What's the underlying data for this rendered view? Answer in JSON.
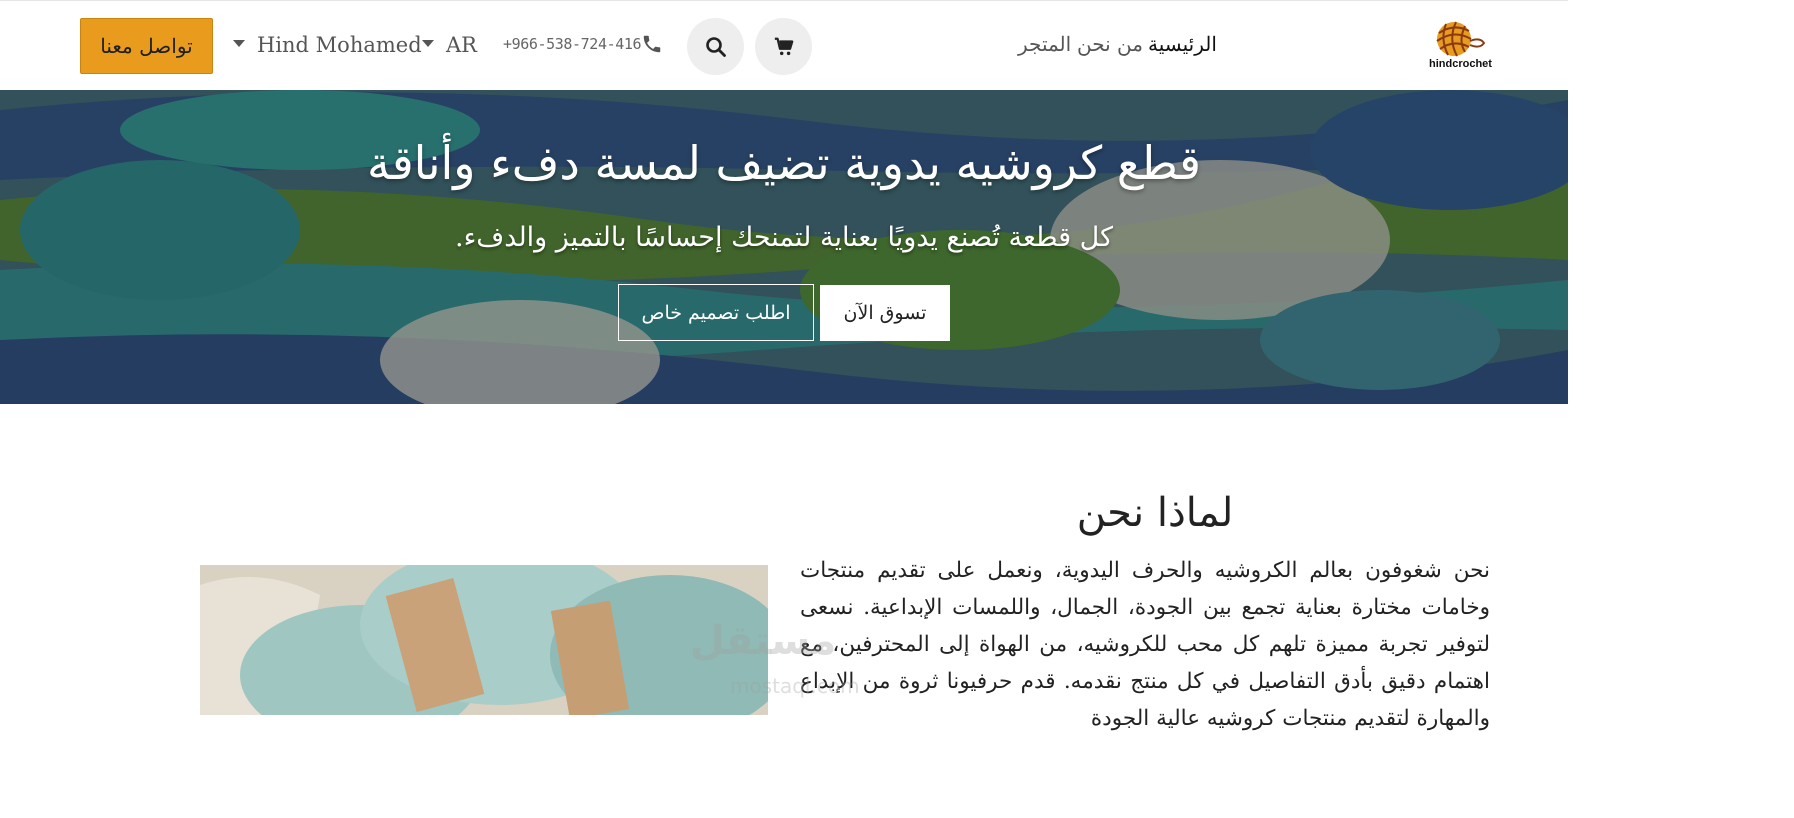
{
  "header": {
    "contact_label": "تواصل معنا",
    "user_name": "Hind Mohamed",
    "language": "AR",
    "phone": "+966-538-724-416",
    "nav": {
      "home": "الرئيسية",
      "about": "من نحن",
      "store": "المتجر"
    },
    "logo_text": "hindcrochet",
    "accent_color": "#e89b1c"
  },
  "hero": {
    "title": "قطع كروشيه يدوية تضيف لمسة دفء وأناقة",
    "subtitle": "كل قطعة تُصنع يدويًا بعناية لتمنحك إحساسًا بالتميز والدفء.",
    "shop_button": "تسوق الآن",
    "custom_button": "اطلب تصميم خاص"
  },
  "about": {
    "title": "لماذا نحن",
    "text": "نحن شغوفون بعالم الكروشيه والحرف اليدوية، ونعمل على تقديم منتجات وخامات مختارة بعناية تجمع بين الجودة، الجمال، واللمسات الإبداعية. نسعى لتوفير تجربة مميزة تلهم كل محب للكروشيه، من الهواة إلى المحترفين، مع اهتمام دقيق بأدق التفاصيل في كل منتج نقدمه. قدم حرفيونا ثروة من الإبداع والمهارة لتقديم منتجات كروشيه عالية الجودة"
  },
  "watermark": {
    "main": "مستقل",
    "sub": "mostaql.com"
  }
}
